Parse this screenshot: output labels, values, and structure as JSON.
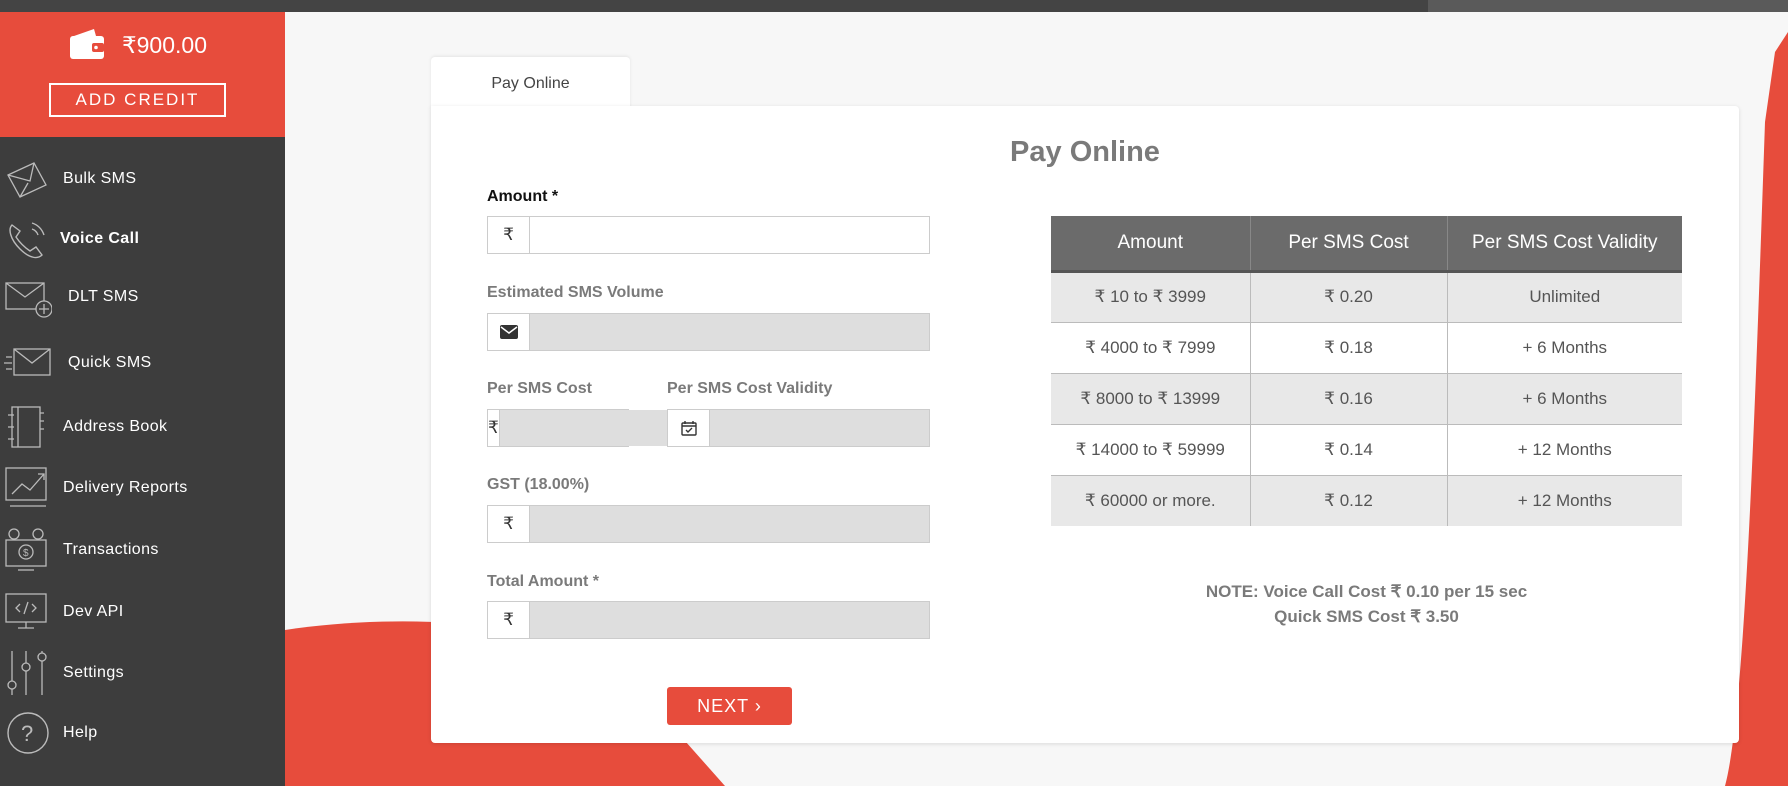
{
  "wallet": {
    "balance": "₹900.00",
    "add_credit": "ADD CREDIT"
  },
  "sidebar": {
    "items": [
      {
        "label": "Bulk SMS",
        "icon": "bulk-sms-icon"
      },
      {
        "label": "Voice Call",
        "icon": "voice-call-icon"
      },
      {
        "label": "DLT SMS",
        "icon": "dlt-sms-icon"
      },
      {
        "label": "Quick SMS",
        "icon": "quick-sms-icon"
      },
      {
        "label": "Address Book",
        "icon": "address-book-icon"
      },
      {
        "label": "Delivery Reports",
        "icon": "delivery-reports-icon"
      },
      {
        "label": "Transactions",
        "icon": "transactions-icon"
      },
      {
        "label": "Dev API",
        "icon": "dev-api-icon"
      },
      {
        "label": "Settings",
        "icon": "settings-icon"
      },
      {
        "label": "Help",
        "icon": "help-icon"
      }
    ]
  },
  "tab": {
    "label": "Pay Online"
  },
  "form": {
    "title": "Pay Online",
    "amount_label": "Amount *",
    "amount_value": "",
    "sms_volume_label": "Estimated SMS Volume",
    "sms_volume_value": "",
    "per_sms_cost_label": "Per SMS Cost",
    "per_sms_cost_value": "",
    "validity_label": "Per SMS Cost Validity",
    "validity_value": "",
    "gst_label": "GST (18.00%)",
    "gst_value": "",
    "total_label": "Total Amount *",
    "total_value": "",
    "currency_symbol": "₹",
    "next_label": "NEXT ›"
  },
  "rate_table": {
    "headers": [
      "Amount",
      "Per SMS Cost",
      "Per SMS Cost Validity"
    ],
    "rows": [
      {
        "amount": "₹ 10  to  ₹ 3999",
        "cost": "₹ 0.20",
        "validity": "Unlimited"
      },
      {
        "amount": "₹ 4000  to  ₹ 7999",
        "cost": "₹ 0.18",
        "validity": "+ 6 Months"
      },
      {
        "amount": "₹ 8000  to  ₹ 13999",
        "cost": "₹ 0.16",
        "validity": "+ 6 Months"
      },
      {
        "amount": "₹ 14000  to  ₹ 59999",
        "cost": "₹ 0.14",
        "validity": "+ 12 Months"
      },
      {
        "amount": "₹ 60000 or more.",
        "cost": "₹ 0.12",
        "validity": "+ 12 Months"
      }
    ]
  },
  "note": {
    "line1": "NOTE: Voice Call Cost ₹ 0.10 per 15 sec",
    "line2": "Quick SMS Cost ₹ 3.50"
  },
  "colors": {
    "accent": "#e74c3c",
    "sidebar": "#3d3d3d",
    "table_header": "#6b6b6b"
  }
}
